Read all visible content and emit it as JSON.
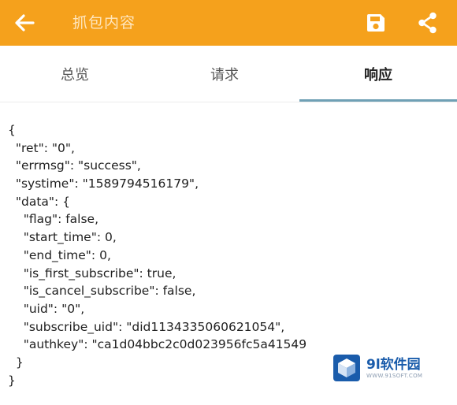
{
  "toolbar": {
    "title": "抓包内容",
    "back_icon": "arrow-left-icon",
    "save_icon": "save-icon",
    "share_icon": "share-icon",
    "background_color": "#F5A11C"
  },
  "tabs": [
    {
      "label": "总览",
      "selected": false
    },
    {
      "label": "请求",
      "selected": false
    },
    {
      "label": "响应",
      "selected": true
    }
  ],
  "response": {
    "lines": [
      "{",
      "  \"ret\": \"0\",",
      "  \"errmsg\": \"success\",",
      "  \"systime\": \"1589794516179\",",
      "  \"data\": {",
      "    \"flag\": false,",
      "    \"start_time\": 0,",
      "    \"end_time\": 0,",
      "    \"is_first_subscribe\": true,",
      "    \"is_cancel_subscribe\": false,",
      "    \"uid\": \"0\",",
      "    \"subscribe_uid\": \"did1134335060621054\",",
      "    \"authkey\": \"ca1d04bbc2c0d023956fc5a41549",
      "  }",
      "}"
    ]
  },
  "watermark": {
    "name": "9l软件园",
    "url": "WWW.91SOFT.COM",
    "logo_color": "#1A5CAB"
  }
}
